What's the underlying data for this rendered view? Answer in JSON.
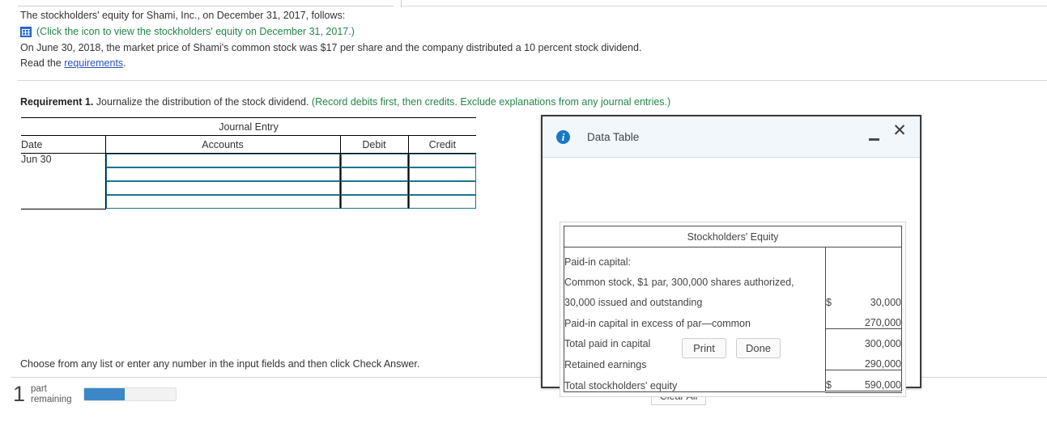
{
  "problem": {
    "line1": "The stockholders' equity for Shami, Inc., on December 31, 2017, follows:",
    "icon_name": "spreadsheet-grid-icon",
    "icon_link_text": "(Click the icon to view the stockholders' equity on December 31, 2017.)",
    "line3": "On June 30, 2018, the market price of Shami's common stock was $17 per share and the company distributed a 10 percent stock dividend.",
    "read_prefix": "Read the ",
    "read_link": "requirements",
    "read_suffix": "."
  },
  "requirement": {
    "label": "Requirement 1.",
    "text": " Journalize the distribution of the stock dividend. ",
    "hint": "(Record debits first, then credits. Exclude explanations from any journal entries.)"
  },
  "journal": {
    "title": "Journal Entry",
    "columns": [
      "Date",
      "Accounts",
      "Debit",
      "Credit"
    ],
    "rows": [
      {
        "date": "Jun 30",
        "accounts": "",
        "debit": "",
        "credit": ""
      },
      {
        "date": "",
        "accounts": "",
        "debit": "",
        "credit": ""
      },
      {
        "date": "",
        "accounts": "",
        "debit": "",
        "credit": ""
      },
      {
        "date": "",
        "accounts": "",
        "debit": "",
        "credit": ""
      }
    ]
  },
  "bottom": {
    "instruction": "Choose from any list or enter any number in the input fields and then click Check Answer.",
    "parts_count": "1",
    "parts_label_line1": "part",
    "parts_label_line2": "remaining",
    "progress_percent": 45,
    "progress_fill_color": "#3b87c8",
    "clear_all_label": "Clear All"
  },
  "dialog": {
    "title": "Data Table",
    "info_icon": "info-icon",
    "minimize_icon": "minimize-icon",
    "close_icon": "close-icon",
    "print_label": "Print",
    "done_label": "Done",
    "table": {
      "title": "Stockholders' Equity",
      "rows": [
        {
          "label": "Paid-in capital:",
          "indent": 0,
          "currency": "",
          "amount": ""
        },
        {
          "label": "Common stock, $1 par, 300,000 shares authorized,",
          "indent": 1,
          "currency": "",
          "amount": ""
        },
        {
          "label": "30,000 issued and outstanding",
          "indent": 2,
          "currency": "$",
          "amount": "30,000"
        },
        {
          "label": "Paid-in capital in excess of par—common",
          "indent": 1,
          "currency": "",
          "amount": "270,000"
        },
        {
          "label": "Total paid in capital",
          "indent": 3,
          "currency": "",
          "amount": "300,000"
        },
        {
          "label": "Retained earnings",
          "indent": 0,
          "currency": "",
          "amount": "290,000"
        },
        {
          "label": "Total stockholders' equity",
          "indent": 0,
          "currency": "$",
          "amount": "590,000"
        }
      ]
    }
  }
}
